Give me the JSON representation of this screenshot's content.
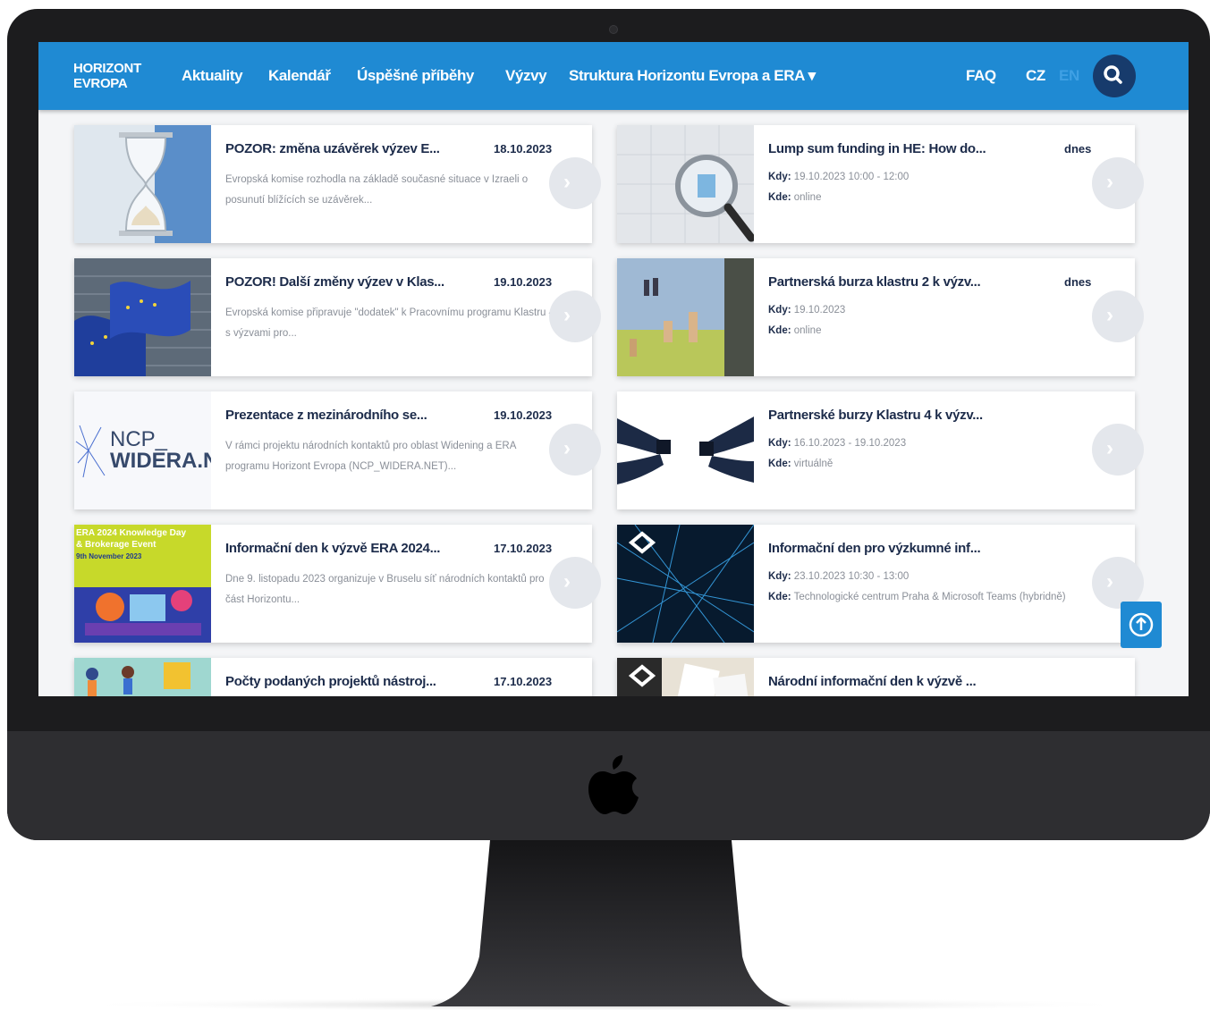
{
  "nav": {
    "brand_line1": "HORIZONT",
    "brand_line2": "EVROPA",
    "items": [
      "Aktuality",
      "Kalendář",
      "Úspěšné příběhy",
      "Výzvy",
      "Struktura Horizontu Evropa a ERA ▾"
    ],
    "faq": "FAQ",
    "lang_cz": "CZ",
    "lang_en": "EN"
  },
  "news": [
    {
      "title": "POZOR: změna uzávěrek výzev E...",
      "date": "18.10.2023",
      "excerpt": "Evropská komise rozhodla na základě současné situace v Izraeli o posunutí blížících se uzávěrek..."
    },
    {
      "title": "POZOR! Další změny výzev v Klas...",
      "date": "19.10.2023",
      "excerpt": "Evropská komise připravuje \"dodatek\" k Pracovnímu programu Klastru 4 s výzvami pro..."
    },
    {
      "title": "Prezentace z mezinárodního se...",
      "date": "19.10.2023",
      "excerpt": "V rámci projektu národních kontaktů pro oblast Widening a ERA programu Horizont Evropa (NCP_WIDERA.NET)..."
    },
    {
      "title": "Informační den k výzvě ERA 2024...",
      "date": "17.10.2023",
      "excerpt": "Dne 9. listopadu 2023 organizuje v Bruselu síť národních kontaktů pro část Horizontu..."
    },
    {
      "title": "Počty podaných projektů nástroj...",
      "date": "17.10.2023",
      "excerpt": ""
    }
  ],
  "events": [
    {
      "title": "Lump sum funding in HE: How do...",
      "date": "dnes",
      "kdy": "19.10.2023 10:00 - 12:00",
      "kde": "online"
    },
    {
      "title": "Partnerská burza klastru 2 k výzv...",
      "date": "dnes",
      "kdy": "19.10.2023",
      "kde": "online"
    },
    {
      "title": "Partnerské burzy Klastru 4 k výzv...",
      "date": "",
      "kdy": "16.10.2023 - 19.10.2023",
      "kde": "virtuálně"
    },
    {
      "title": "Informační den pro výzkumné inf...",
      "date": "",
      "kdy": "23.10.2023 10:30 - 13:00",
      "kde": "Technologické centrum Praha & Microsoft Teams (hybridně)"
    },
    {
      "title": "Národní informační den k výzvě ...",
      "date": "",
      "kdy": "",
      "kde": ""
    }
  ],
  "labels": {
    "kdy": "Kdy:",
    "kde": "Kde:"
  },
  "thumbs": {
    "ncp_line1": "NCP_",
    "ncp_line2": "WIDERA.N",
    "era_line1": "ERA 2024 Knowledge Day",
    "era_line2": "& Brokerage Event",
    "era_line3": "9th November 2023"
  },
  "icons": {
    "arrow": "chevron-right-icon",
    "search": "search-icon",
    "top": "arrow-up-circle-icon",
    "apple": "apple-logo-icon"
  }
}
